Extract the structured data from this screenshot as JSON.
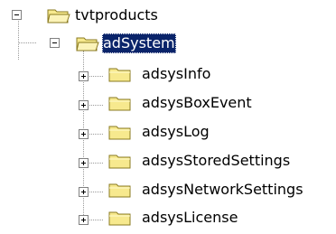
{
  "tree": {
    "root": {
      "label": "tvtproducts",
      "icon": "folder-open-icon",
      "expanded": true
    },
    "selected_node": {
      "label": "adSystem",
      "icon": "folder-open-icon",
      "expanded": true
    },
    "children": [
      {
        "label": "adsysInfo",
        "icon": "folder-icon",
        "expanded": false
      },
      {
        "label": "adsysBoxEvent",
        "icon": "folder-icon",
        "expanded": false
      },
      {
        "label": "adsysLog",
        "icon": "folder-icon",
        "expanded": false
      },
      {
        "label": "adsysStoredSettings",
        "icon": "folder-icon",
        "expanded": false
      },
      {
        "label": "adsysNetworkSettings",
        "icon": "folder-icon",
        "expanded": false
      },
      {
        "label": "adsysLicense",
        "icon": "folder-icon",
        "expanded": false
      }
    ]
  },
  "colors": {
    "selection_background": "#0a246a",
    "selection_text": "#ffffff",
    "folder_yellow": "#f7e98e",
    "folder_outline": "#8a7a20",
    "tree_lines": "#9a9a9a"
  }
}
